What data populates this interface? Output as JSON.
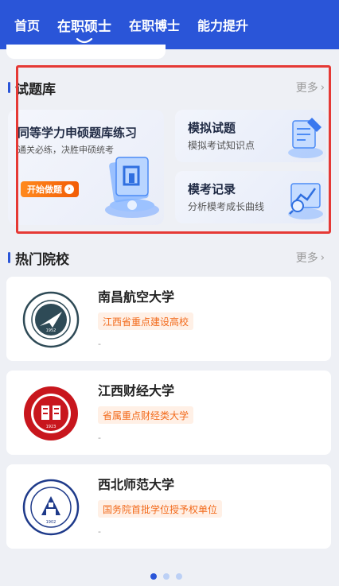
{
  "nav": {
    "tabs": [
      {
        "label": "首页"
      },
      {
        "label": "在职硕士"
      },
      {
        "label": "在职博士"
      },
      {
        "label": "能力提升"
      }
    ]
  },
  "question_bank": {
    "title": "试题库",
    "more_label": "更多",
    "main_card": {
      "title": "同等学力申硕题库练习",
      "subtitle": "通关必练，决胜申硕统考",
      "button_label": "开始做题"
    },
    "cards": [
      {
        "title": "模拟试题",
        "subtitle": "模拟考试知识点"
      },
      {
        "title": "模考记录",
        "subtitle": "分析模考成长曲线"
      }
    ]
  },
  "schools": {
    "title": "热门院校",
    "more_label": "更多",
    "items": [
      {
        "name": "南昌航空大学",
        "tag": "江西省重点建设高校",
        "meta": "-"
      },
      {
        "name": "江西财经大学",
        "tag": "省属重点财经类大学",
        "meta": "-"
      },
      {
        "name": "西北师范大学",
        "tag": "国务院首批学位授予权单位",
        "meta": "-"
      }
    ]
  },
  "colors": {
    "brand_blue": "#2a55d8",
    "tag_orange": "#f26a1b",
    "highlight_red": "#e53935"
  }
}
